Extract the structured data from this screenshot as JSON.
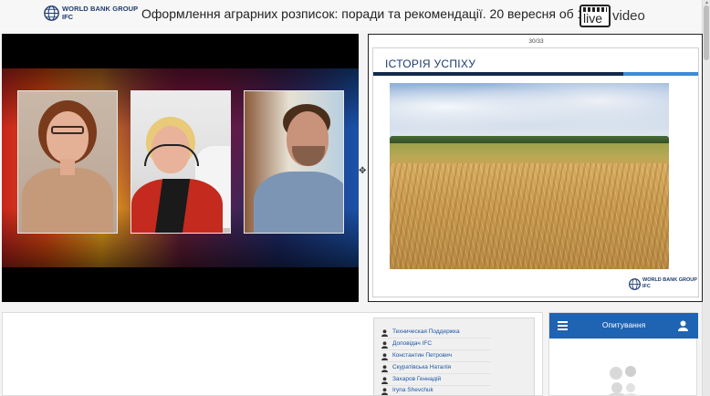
{
  "header": {
    "title": "Оформлення аграрних розписок: поради та рекомендації. 20 вересня об 11.00",
    "org_logo": {
      "line1": "WORLD BANK GROUP",
      "line2": "IFC",
      "icon": "globe-icon"
    },
    "brand_logo": {
      "live": "live",
      "video": "video",
      "icon": "clapperboard-icon"
    }
  },
  "video": {
    "participants": [
      "participant-1",
      "participant-2",
      "participant-3"
    ]
  },
  "slide": {
    "counter": "30/33",
    "title": "ІСТОРІЯ УСПІХУ",
    "logo": {
      "line1": "WORLD BANK GROUP",
      "line2": "IFC"
    }
  },
  "users": {
    "items": [
      "Техническая Поддержка",
      "Доповідач IFC",
      "Константин Петрович",
      "Скуратівська Наталія",
      "Захаров Геннадій",
      "Iryna Shevchuk"
    ]
  },
  "poll": {
    "title": "Опитування"
  },
  "colors": {
    "accent": "#1f63b3",
    "link": "#1a56a8",
    "slide_title": "#1a3a6b"
  }
}
